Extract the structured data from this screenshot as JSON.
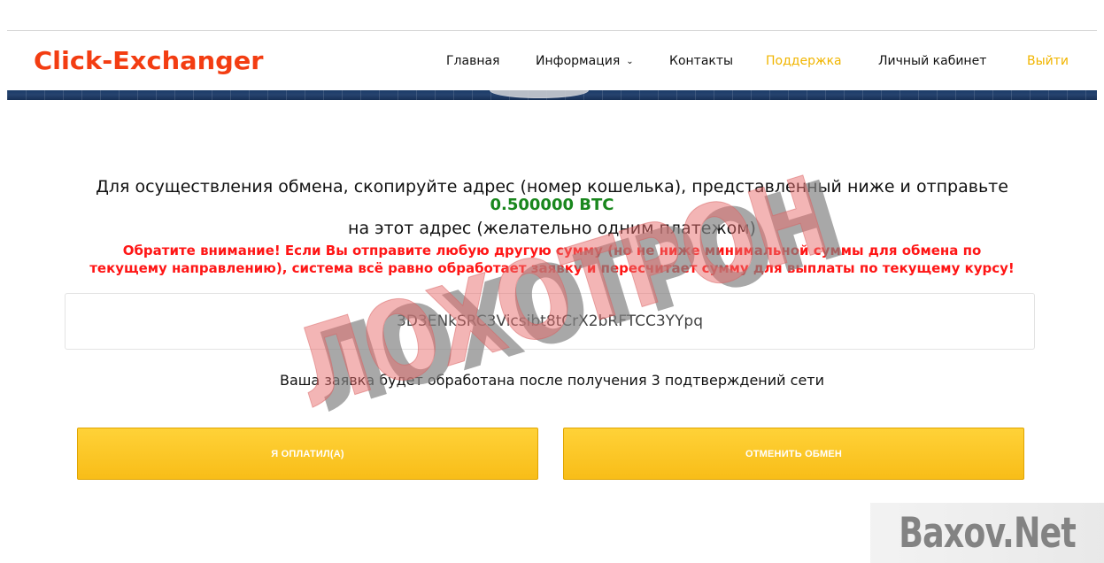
{
  "site": {
    "logo": "Click-Exchanger"
  },
  "nav": {
    "items": [
      {
        "label": "Главная"
      },
      {
        "label": "Информация"
      },
      {
        "label": "Контакты"
      },
      {
        "label": "Поддержка"
      },
      {
        "label": "Личный кабинет"
      },
      {
        "label": "Выйти"
      }
    ]
  },
  "main": {
    "instruction_line_1": "Для осуществления обмена, скопируйте адрес (номер кошелька), представленный ниже и отправьте",
    "amount": "0.500000 BTC",
    "instruction_line_2": "на этот адрес (желательно одним платежом)",
    "warning_line_1": "Обратите внимание! Если Вы отправите любую другую сумму (но не ниже минимальной суммы для обмена по",
    "warning_line_2": "текущему направлению), система всё равно обработает заявку и пересчитает сумму для выплаты по текущему курсу!",
    "wallet_address": "3D3ENkSRC3Vicsibt8tCrX2bRFTCC3YYpq",
    "confirmations_text": "Ваша заявка будет обработана после получения 3 подтверждений сети",
    "buttons": {
      "paid": "Я ОПЛАТИЛ(А)",
      "cancel": "ОТМЕНИТЬ ОБМЕН"
    }
  },
  "overlay": {
    "stamp": "ЛОХОТРОН",
    "watermark": "Baxov.Net"
  },
  "colors": {
    "logo": "#f33d12",
    "orange_nav": "#f1b500",
    "amount_green": "#19871d",
    "warning_red": "#ff1616",
    "button_yellow": "#f8bd18"
  },
  "icons": {
    "dropdown": "chevron-down-icon"
  }
}
